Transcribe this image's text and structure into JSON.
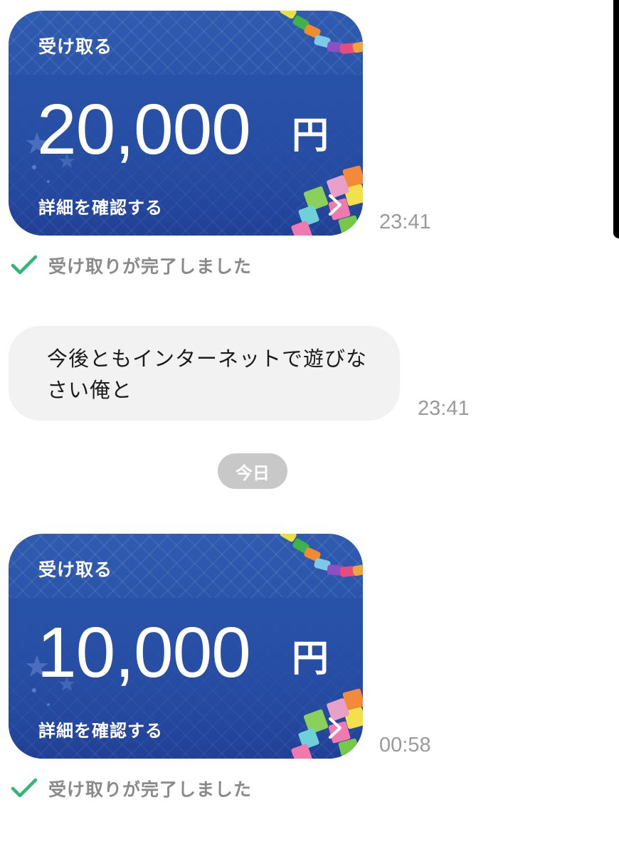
{
  "messages": [
    {
      "type": "payment",
      "title": "受け取る",
      "amount": "20,000",
      "currency": "円",
      "detail_label": "詳細を確認する",
      "time": "23:41",
      "status": "受け取りが完了しました"
    },
    {
      "type": "text",
      "text": "今後ともインターネットで遊びなさい俺と",
      "time": "23:41"
    },
    {
      "type": "date_separator",
      "label": "今日"
    },
    {
      "type": "payment",
      "title": "受け取る",
      "amount": "10,000",
      "currency": "円",
      "detail_label": "詳細を確認する",
      "time": "00:58",
      "status": "受け取りが完了しました"
    }
  ],
  "colors": {
    "card_blue": "#264fa4",
    "status_check": "#2eb872",
    "bubble_bg": "#f2f2f2",
    "pill_bg": "#c8c8c8",
    "timestamp": "#9a9a9a"
  },
  "icons": [
    "chevron-right-icon",
    "checkmark-icon",
    "paper-chain-decoration",
    "origami-squares-decoration",
    "star-decoration"
  ]
}
